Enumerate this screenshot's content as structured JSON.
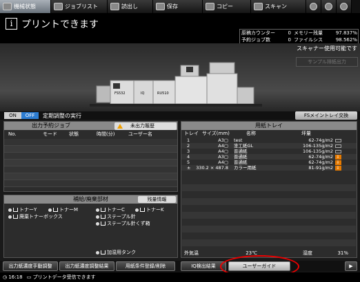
{
  "tabs": [
    {
      "label": "機械状態",
      "icon": "machine-icon"
    },
    {
      "label": "ジョブリスト",
      "icon": "job-list-icon"
    },
    {
      "label": "読出し",
      "icon": "recall-icon"
    },
    {
      "label": "保存",
      "icon": "store-icon"
    },
    {
      "label": "コピー",
      "icon": "copy-icon"
    },
    {
      "label": "スキャン",
      "icon": "scan-icon"
    }
  ],
  "header": {
    "message": "プリントできます",
    "scanner_message": "スキャナー使用可能です",
    "sample_button": "サンプル排紙出力"
  },
  "counters": {
    "row1": {
      "label": "原稿カウンター",
      "value": "0",
      "label2": "メモリー残量",
      "value2": "97.837%"
    },
    "row2": {
      "label": "予約ジョブ数",
      "value": "0",
      "label2": "ファイルシステム残量",
      "value2": "98.562%"
    }
  },
  "machine_labels": {
    "unit1": "FS532",
    "unit2": "IQ",
    "unit3": "RU510"
  },
  "adjustment": {
    "on": "ON",
    "off": "OFF",
    "label": "定期調整の実行",
    "fs_button": "FSメイントレイ交換"
  },
  "jobs": {
    "title": "出力予約ジョブ",
    "unprinted_button": "未出力履歴",
    "columns": [
      "No.",
      "モード",
      "状態",
      "時間(分)",
      "ユーザー名"
    ]
  },
  "supplies": {
    "title": "補給/廃棄部材",
    "stock_button": "残量情報",
    "items": [
      "トナーY",
      "トナーM",
      "トナーC",
      "トナーK",
      "廃棄トナーボックス",
      "ステープル針",
      "ステープル針くず箱",
      "加湿用タンク"
    ]
  },
  "trays": {
    "title": "用紙トレイ",
    "columns": [
      "トレイ",
      "サイズ(mm)",
      "名称",
      "坪量"
    ],
    "rows": [
      {
        "tray": "1",
        "size": "A3▢",
        "name": "test",
        "weight": "62-74g/m2",
        "status": "gauge"
      },
      {
        "tray": "2",
        "size": "A4▢",
        "name": "塗工紙GL",
        "weight": "106-135g/m2",
        "status": "gauge"
      },
      {
        "tray": "3",
        "size": "A4▢",
        "name": "普通紙",
        "weight": "106-135g/m2",
        "status": "gauge"
      },
      {
        "tray": "4",
        "size": "A3▢",
        "name": "普通紙",
        "weight": "62-74g/m2",
        "status": "arrow"
      },
      {
        "tray": "5",
        "size": "A4▢",
        "name": "普通紙",
        "weight": "62-74g/m2",
        "status": "arrow"
      },
      {
        "tray": "±",
        "size": "330.2 × 487.8",
        "name": "カラー用紙",
        "weight": "81-91g/m2",
        "status": "arrow"
      }
    ],
    "env_label": "外気温",
    "env_value": "23℃",
    "humidity_label": "湿度",
    "humidity_value": "31%"
  },
  "bottom_buttons": {
    "b1": "出力紙濃度手動調整",
    "b2": "出力紙濃度調整結果",
    "b3": "用紙条件登録/削除",
    "b4": "IQ検出結果",
    "b5": "ユーザーガイド"
  },
  "footer": {
    "time": "16:18",
    "message": "プリントデータ受信できます"
  }
}
